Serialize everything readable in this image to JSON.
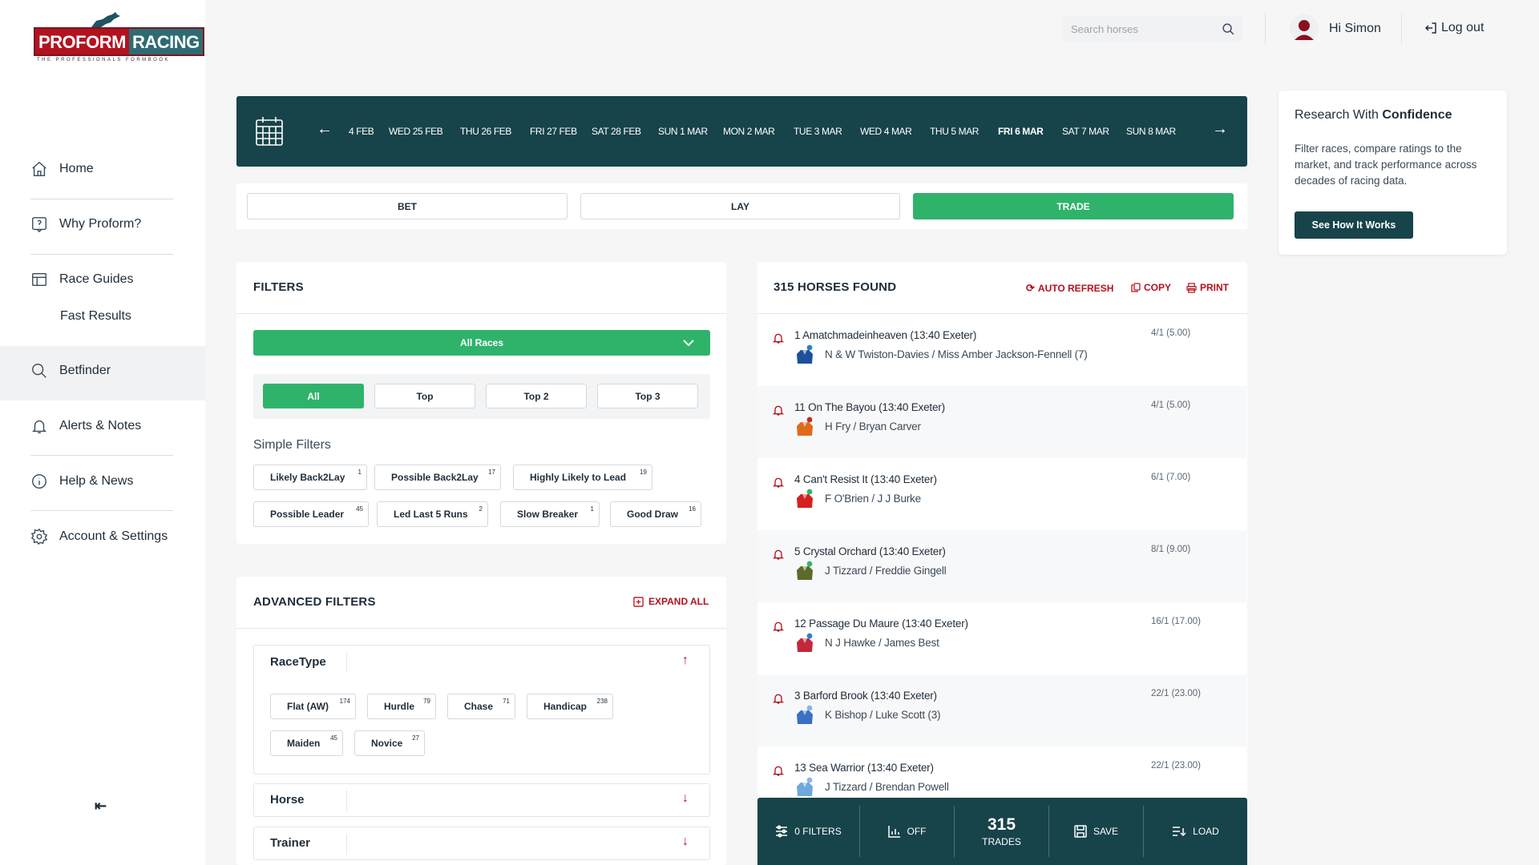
{
  "brand": {
    "left": "PROFORM",
    "right": "RACING",
    "tagline": "THE PROFESSIONALS FORMBOOK"
  },
  "sidebar": {
    "items": [
      {
        "label": "Home",
        "icon": "home-icon"
      },
      {
        "label": "Why Proform?",
        "icon": "help-square-icon"
      },
      {
        "label": "Race Guides",
        "icon": "table-icon"
      },
      {
        "label": "Fast Results",
        "icon": ""
      },
      {
        "label": "Betfinder",
        "icon": "search-icon"
      },
      {
        "label": "Alerts & Notes",
        "icon": "bell-icon"
      },
      {
        "label": "Help & News",
        "icon": "info-icon"
      },
      {
        "label": "Account & Settings",
        "icon": "gear-icon"
      }
    ],
    "collapse_icon": "collapse-left-icon"
  },
  "header": {
    "search_placeholder": "Search horses",
    "greeting": "Hi Simon",
    "logout": "Log out"
  },
  "dates": {
    "items": [
      "4 FEB",
      "WED 25 FEB",
      "THU 26 FEB",
      "FRI 27 FEB",
      "SAT 28 FEB",
      "SUN 1 MAR",
      "MON 2 MAR",
      "TUE 3 MAR",
      "WED 4 MAR",
      "THU 5 MAR",
      "FRI 6 MAR",
      "SAT 7 MAR",
      "SUN 8 MAR"
    ],
    "selected": "FRI 6 MAR"
  },
  "modes": {
    "bet": "BET",
    "lay": "LAY",
    "trade": "TRADE",
    "selected": "TRADE"
  },
  "filters": {
    "title": "FILTERS",
    "race_select": "All Races",
    "segments": [
      "All",
      "Top",
      "Top 2",
      "Top 3"
    ],
    "segment_selected": "All",
    "simple_label": "Simple Filters",
    "simple": [
      {
        "label": "Likely Back2Lay",
        "count": "1"
      },
      {
        "label": "Possible Back2Lay",
        "count": "17"
      },
      {
        "label": "Highly Likely to Lead",
        "count": "19"
      },
      {
        "label": "Possible Leader",
        "count": "45"
      },
      {
        "label": "Led Last 5 Runs",
        "count": "2"
      },
      {
        "label": "Slow Breaker",
        "count": "1"
      },
      {
        "label": "Good Draw",
        "count": "16"
      }
    ]
  },
  "advanced": {
    "title": "ADVANCED FILTERS",
    "expand_all": "EXPAND ALL",
    "racetype_title": "RaceType",
    "racetypes": [
      {
        "label": "Flat (AW)",
        "count": "174"
      },
      {
        "label": "Hurdle",
        "count": "79"
      },
      {
        "label": "Chase",
        "count": "71"
      },
      {
        "label": "Handicap",
        "count": "238"
      },
      {
        "label": "Maiden",
        "count": "45"
      },
      {
        "label": "Novice",
        "count": "27"
      }
    ],
    "horse_title": "Horse",
    "trainer_title": "Trainer"
  },
  "results": {
    "title": "315 HORSES FOUND",
    "auto_refresh": "AUTO REFRESH",
    "copy": "COPY",
    "print": "PRINT",
    "horses": [
      {
        "name": "1 Amatchmadeinheaven (13:40 Exeter)",
        "connections": "N & W Twiston-Davies / Miss Amber Jackson-Fennell (7)",
        "odds": "4/1 (5.00)",
        "silk": "#1d4f9a",
        "dot": "#2a7fd4"
      },
      {
        "name": "11 On The Bayou (13:40 Exeter)",
        "connections": "H Fry / Bryan Carver",
        "odds": "4/1 (5.00)",
        "silk": "#e06a1a",
        "dot": "#c62828"
      },
      {
        "name": "4 Can't Resist It (13:40 Exeter)",
        "connections": "F O'Brien / J J Burke",
        "odds": "6/1 (7.00)",
        "silk": "#d62020",
        "dot": "#2fb36b"
      },
      {
        "name": "5 Crystal Orchard (13:40 Exeter)",
        "connections": "J Tizzard / Freddie Gingell",
        "odds": "8/1 (9.00)",
        "silk": "#5a6b2a",
        "dot": "#2fb36b"
      },
      {
        "name": "12 Passage Du Maure (13:40 Exeter)",
        "connections": "N J Hawke / James Best",
        "odds": "16/1 (17.00)",
        "silk": "#c2283c",
        "dot": "#2a7fd4"
      },
      {
        "name": "3 Barford Brook (13:40 Exeter)",
        "connections": "K Bishop / Luke Scott (3)",
        "odds": "22/1 (23.00)",
        "silk": "#3a6fc4",
        "dot": "#8ab4e8"
      },
      {
        "name": "13 Sea Warrior (13:40 Exeter)",
        "connections": "J Tizzard / Brendan Powell",
        "odds": "22/1 (23.00)",
        "silk": "#6fa8dc",
        "dot": "#8ab4e8"
      }
    ]
  },
  "toolbar": {
    "filters": "0 FILTERS",
    "off": "OFF",
    "trades_count": "315",
    "trades_label": "TRADES",
    "save": "SAVE",
    "load": "LOAD"
  },
  "research": {
    "title_plain": "Research With ",
    "title_bold": "Confidence",
    "body": "Filter races, compare ratings to the market, and track performance across decades of racing data.",
    "cta": "See How It Works"
  },
  "colors": {
    "accent_green": "#2fb36b",
    "dark_teal": "#17434a",
    "brand_red": "#b3121f"
  }
}
